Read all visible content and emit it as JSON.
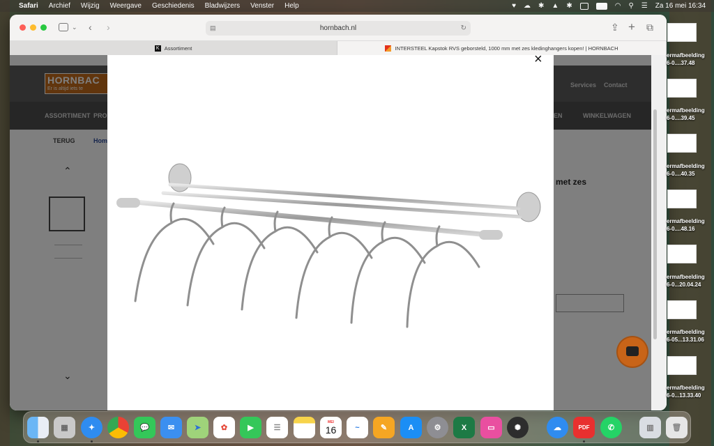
{
  "menubar": {
    "items": [
      "Safari",
      "Archief",
      "Wijzig",
      "Weergave",
      "Geschiedenis",
      "Bladwijzers",
      "Venster",
      "Help"
    ],
    "datetime": "Za 16 mei  16:34"
  },
  "browser": {
    "address": "hornbach.nl",
    "tabs": [
      {
        "label": "Assortiment"
      },
      {
        "label": "INTERSTEEL Kapstok RVS geborsteld, 1000 mm met zes kledinghangers kopen! | HORNBACH"
      }
    ]
  },
  "page": {
    "logo_text": "HORNBAC",
    "logo_slogan": "Er is altijd iets te",
    "nav_top": [
      "Services",
      "Contact"
    ],
    "nav_main_left": [
      "ASSORTIMENT",
      "PRO"
    ],
    "nav_main_right": [
      "EN",
      "WINKELWAGEN"
    ],
    "back_label": "TERUG",
    "breadcrumb": "Hom",
    "product_title_partial": "met zes"
  },
  "modal": {
    "close_glyph": "×"
  },
  "sidebar_files": [
    {
      "label_line1": "ermafbeelding",
      "label_line2": "6-0....37.48"
    },
    {
      "label_line1": "ermafbeelding",
      "label_line2": "6-0....39.45"
    },
    {
      "label_line1": "ermafbeelding",
      "label_line2": "6-0....40.35"
    },
    {
      "label_line1": "ermafbeelding",
      "label_line2": "6-0....48.16"
    },
    {
      "label_line1": "ermafbeelding",
      "label_line2": "6-0...20.04.24"
    },
    {
      "label_line1": "ermafbeelding",
      "label_line2": "6-05...13.31.06"
    },
    {
      "label_line1": "ermafbeelding",
      "label_line2": "6-0...13.33.40"
    }
  ],
  "dock": {
    "calendar_month": "MEI",
    "calendar_day": "16",
    "pdf_label": "PDF"
  },
  "colors": {
    "hornbach_orange": "#c86418",
    "header_gray": "#5a5a5a"
  }
}
